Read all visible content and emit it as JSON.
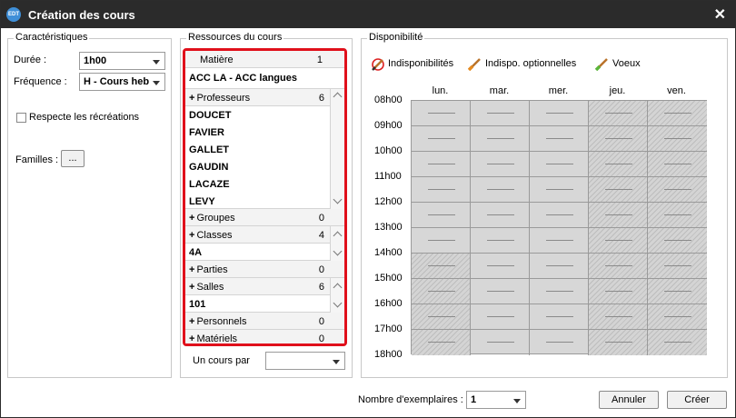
{
  "window": {
    "title": "Création des cours",
    "icon_label": "EDT"
  },
  "caracteristiques": {
    "legend": "Caractéristiques",
    "duree_label": "Durée :",
    "duree_value": "1h00",
    "frequence_label": "Fréquence :",
    "frequence_value": "H - Cours heb",
    "recreations_label": "Respecte les récréations",
    "familles_label": "Familles :",
    "familles_button": "..."
  },
  "ressources": {
    "legend": "Ressources du cours",
    "matiere": {
      "label": "Matière",
      "count": "1",
      "value": "ACC LA - ACC langues"
    },
    "professeurs": {
      "label": "Professeurs",
      "count": "6",
      "items": [
        "DOUCET",
        "FAVIER",
        "GALLET",
        "GAUDIN",
        "LACAZE",
        "LEVY"
      ]
    },
    "groupes": {
      "label": "Groupes",
      "count": "0"
    },
    "classes": {
      "label": "Classes",
      "count": "4",
      "value": "4A"
    },
    "parties": {
      "label": "Parties",
      "count": "0"
    },
    "salles": {
      "label": "Salles",
      "count": "6",
      "value": "101"
    },
    "personnels": {
      "label": "Personnels",
      "count": "0"
    },
    "materiels": {
      "label": "Matériels",
      "count": "0"
    },
    "un_cours_par_label": "Un cours par",
    "un_cours_par_value": ""
  },
  "disponibilite": {
    "legend": "Disponibilité",
    "tools": [
      "Indisponibilités",
      "Indispo. optionnelles",
      "Voeux"
    ],
    "days": [
      "lun.",
      "mar.",
      "mer.",
      "jeu.",
      "ven."
    ],
    "hours": [
      "08h00",
      "09h00",
      "10h00",
      "11h00",
      "12h00",
      "13h00",
      "14h00",
      "15h00",
      "16h00",
      "17h00",
      "18h00"
    ]
  },
  "footer": {
    "exemplaires_label": "Nombre d'exemplaires :",
    "exemplaires_value": "1",
    "cancel": "Annuler",
    "create": "Créer"
  },
  "colors": {
    "accent": "#e0101b",
    "titlebar": "#2b2b2b"
  }
}
